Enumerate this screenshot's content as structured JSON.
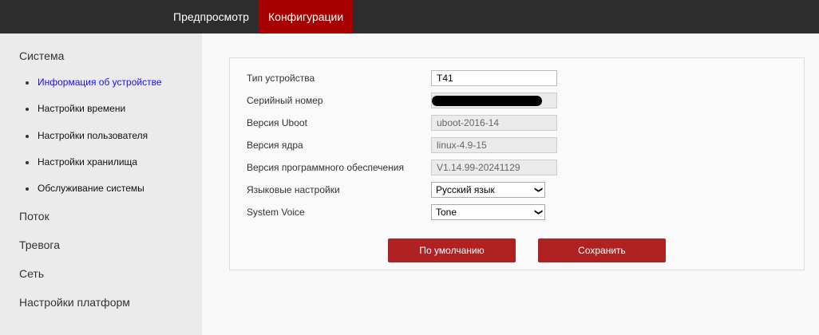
{
  "topbar": {
    "tabs": [
      {
        "label": "Предпросмотр"
      },
      {
        "label": "Конфигурации"
      }
    ],
    "active_color": "#a80000"
  },
  "sidebar": {
    "sections": [
      {
        "label": "Система",
        "items": [
          {
            "label": "Информация об устройстве"
          },
          {
            "label": "Настройки времени"
          },
          {
            "label": "Настройки пользователя"
          },
          {
            "label": "Настройки хранилища"
          },
          {
            "label": "Обслуживание системы"
          }
        ]
      },
      {
        "label": "Поток"
      },
      {
        "label": "Тревога"
      },
      {
        "label": "Сеть"
      },
      {
        "label": "Настройки платформ"
      }
    ]
  },
  "form": {
    "device_type": {
      "label": "Тип устройства",
      "value": "T41"
    },
    "serial": {
      "label": "Серийный номер",
      "value": ""
    },
    "uboot": {
      "label": "Версия Uboot",
      "value": "uboot-2016-14"
    },
    "kernel": {
      "label": "Версия ядра",
      "value": "linux-4.9-15"
    },
    "software": {
      "label": "Версия программного обеспечения",
      "value": "V1.14.99-20241129"
    },
    "language": {
      "label": "Языковые настройки",
      "value": "Русский язык"
    },
    "voice": {
      "label": "System Voice",
      "value": "Tone"
    },
    "default_label": "По умолчанию",
    "save_label": "Сохранить"
  }
}
